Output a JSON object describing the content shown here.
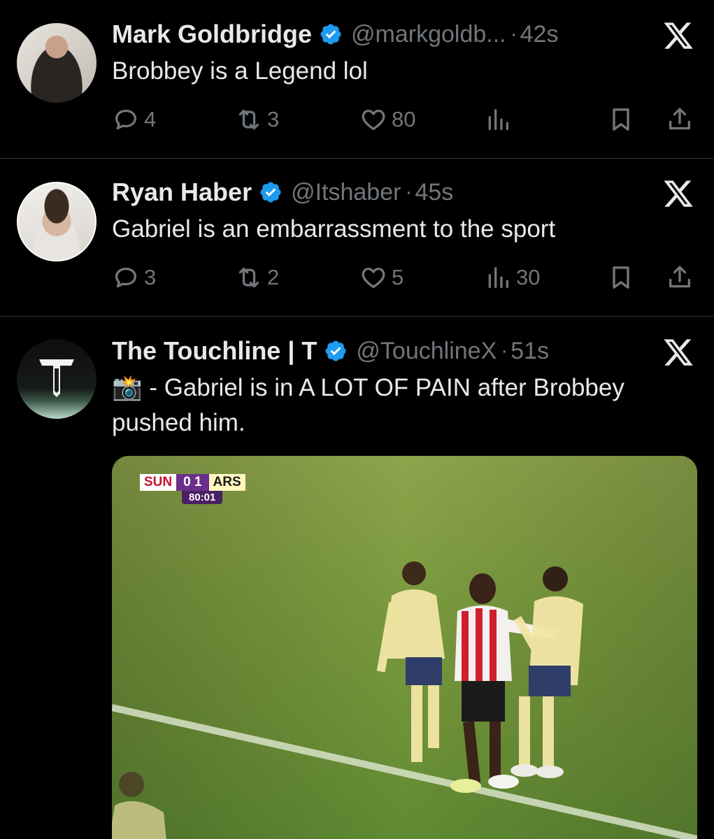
{
  "tweets": [
    {
      "name": "Mark Goldbridge",
      "handle": "@markgoldb...",
      "time": "42s",
      "text": "Brobbey is a Legend lol",
      "replies": "4",
      "retweets": "3",
      "likes": "80",
      "views": ""
    },
    {
      "name": "Ryan Haber",
      "handle": "@Itshaber",
      "time": "45s",
      "text": "Gabriel is an embarrassment to the sport",
      "replies": "3",
      "retweets": "2",
      "likes": "5",
      "views": "30"
    },
    {
      "name": "The Touchline | T",
      "handle": "@TouchlineX",
      "time": "51s",
      "text_emoji": "📸",
      "text": " - Gabriel is in A LOT OF PAIN after Brobbey pushed him.",
      "media": {
        "home": "SUN",
        "score": "0 1",
        "away": "ARS",
        "clock": "80:01"
      }
    }
  ],
  "separator": "·",
  "colors": {
    "accent": "#1d9bf0",
    "muted": "#71767b",
    "text": "#e7e9ea",
    "divider": "#2f3336"
  },
  "icons": [
    "verified-badge-icon",
    "x-logo-icon",
    "reply-icon",
    "retweet-icon",
    "like-icon",
    "views-icon",
    "bookmark-icon",
    "share-icon"
  ]
}
